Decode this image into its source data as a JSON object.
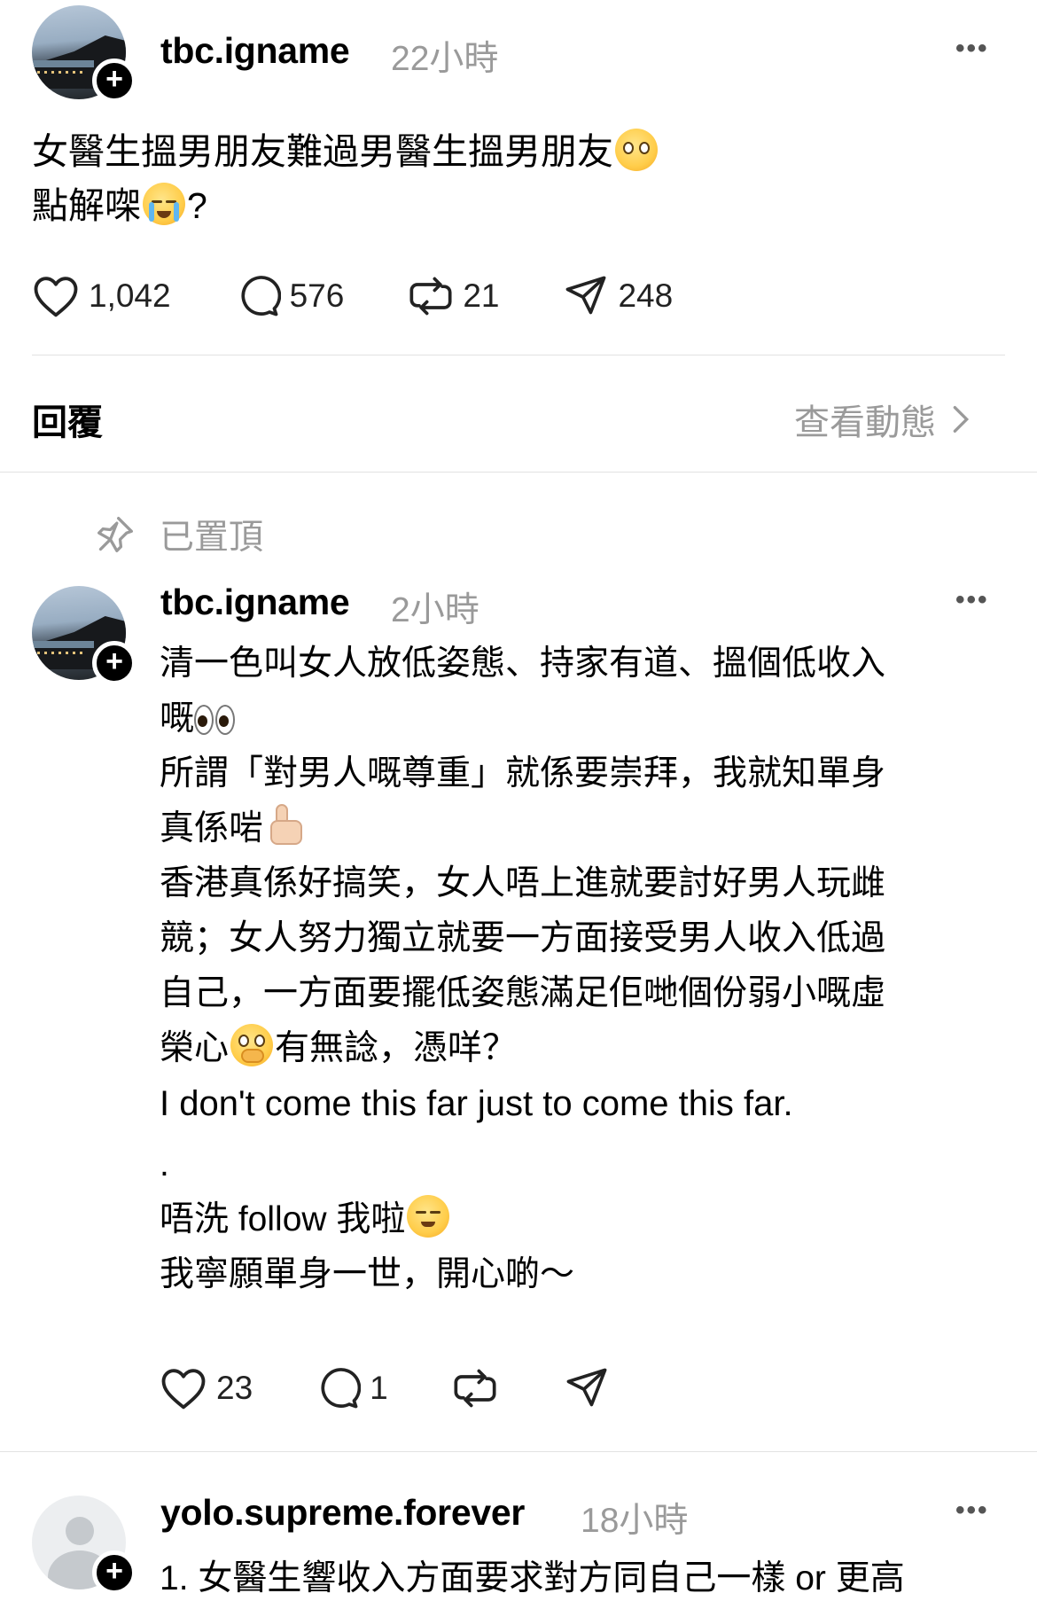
{
  "original_post": {
    "username": "tbc.igname",
    "time": "22小時",
    "text_line1": "女醫生搵男朋友難過男醫生搵男朋友",
    "text_line2": "點解㗎",
    "text_line2_suffix": "?",
    "emoji1": "pleading-face-emoji",
    "emoji2": "loudly-crying-face-emoji",
    "likes": "1,042",
    "comments": "576",
    "reposts": "21",
    "shares": "248"
  },
  "replies_header": {
    "label": "回覆",
    "view_activity": "查看動態"
  },
  "pinned": {
    "label": "已置頂"
  },
  "pinned_reply": {
    "username": "tbc.igname",
    "time": "2小時",
    "lines": {
      "l1": "清一色叫女人放低姿態、持家有道、搵個低收入",
      "l2": "嘅",
      "l3": "所謂「對男人嘅尊重」就係要崇拜，我就知單身",
      "l4": "真係啱",
      "l5": "香港真係好搞笑，女人唔上進就要討好男人玩雌",
      "l6": "競；女人努力獨立就要一方面接受男人收入低過",
      "l7": "自己，一方面要擺低姿態滿足佢哋個份弱小嘅虛",
      "l8a": "榮心",
      "l8b": "有無諗，憑咩？",
      "l9": "I don't come this far just to come this far.",
      "l10": ".",
      "l11": "唔洗 follow 我啦",
      "l12": "我寧願單身一世，開心啲～"
    },
    "likes": "23",
    "comments": "1"
  },
  "next_reply": {
    "username": "yolo.supreme.forever",
    "time": "18小時",
    "text_preview": "1. 女醫生響收入方面要求對方同自己一樣 or 更高"
  }
}
